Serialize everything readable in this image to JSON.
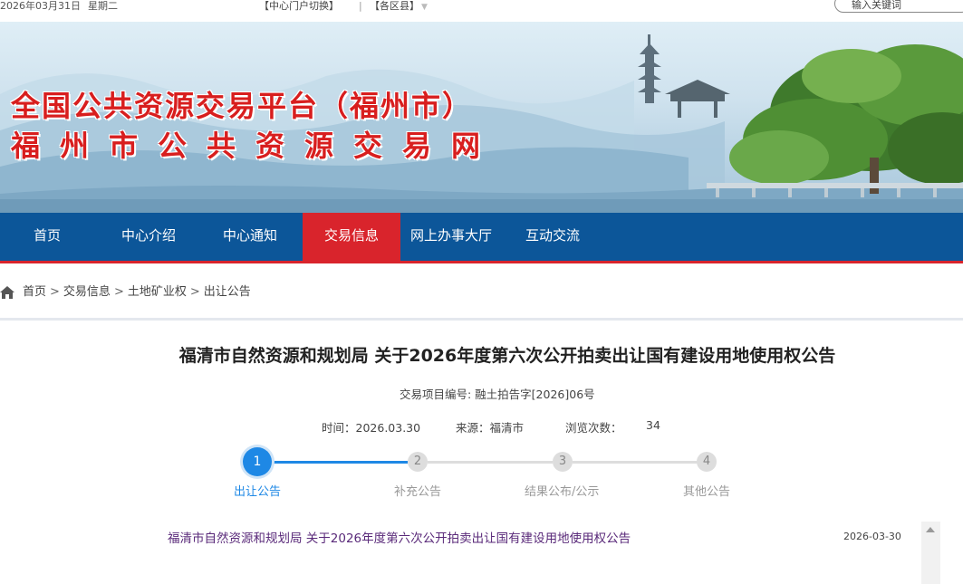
{
  "topbar": {
    "date": "2026年03月31日",
    "weekday": "星期二",
    "portal_switch": "【中心门户切换】",
    "separator": "|",
    "district": "【各区县】",
    "search_placeholder": "输入关键词"
  },
  "banner": {
    "title_line1": "全国公共资源交易平台（福州市）",
    "title_line2": "福州市公共资源交易网"
  },
  "nav": {
    "items": [
      "首页",
      "中心介绍",
      "中心通知",
      "交易信息",
      "网上办事大厅",
      "互动交流"
    ],
    "active": "交易信息"
  },
  "breadcrumb": {
    "items": [
      "首页",
      "交易信息",
      "土地矿业权",
      "出让公告"
    ],
    "separator": ">"
  },
  "article": {
    "title": "福清市自然资源和规划局 关于2026年度第六次公开拍卖出让国有建设用地使用权公告",
    "project_no": "交易项目编号: 融土拍告字[2026]06号",
    "time_label": "时间：",
    "time_value": "2026.03.30",
    "source_label": "来源：",
    "source_value": "福清市",
    "views_label": "浏览次数：",
    "views_value": "34"
  },
  "steps": [
    {
      "num": "1",
      "label": "出让公告",
      "active": true
    },
    {
      "num": "2",
      "label": "补充公告",
      "active": false
    },
    {
      "num": "3",
      "label": "结果公布/公示",
      "active": false
    },
    {
      "num": "4",
      "label": "其他公告",
      "active": false
    }
  ],
  "list": [
    {
      "title": "福清市自然资源和规划局 关于2026年度第六次公开拍卖出让国有建设用地使用权公告",
      "date": "2026-03-30"
    }
  ],
  "colors": {
    "nav_bg": "#0c5699",
    "nav_active": "#d9242c",
    "step_active": "#1e88e5",
    "title_red": "#d81e1e"
  }
}
